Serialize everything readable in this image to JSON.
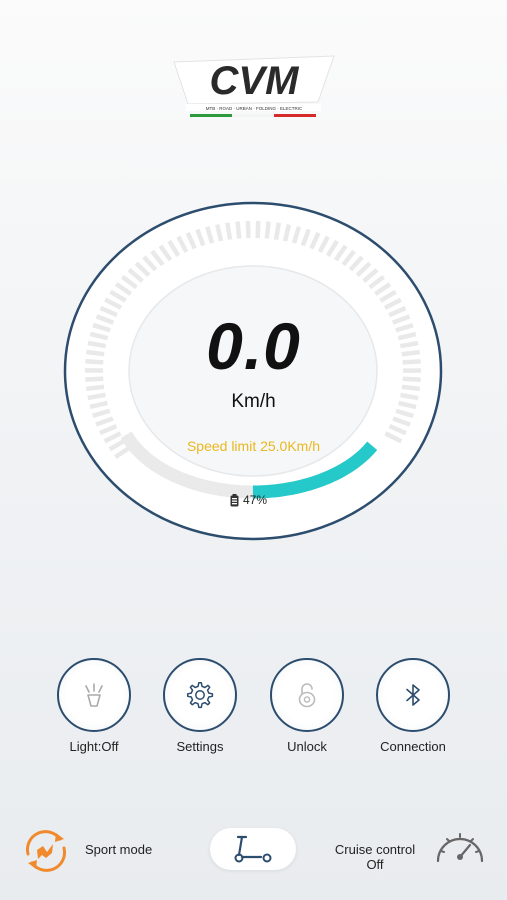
{
  "brand": {
    "logo_text": "CVM",
    "tagline": "MTB · ROAD · URBAN · FOLDING · ELECTRIC"
  },
  "dashboard": {
    "speed": "0.0",
    "unit": "Km/h",
    "speed_limit": "Speed limit  25.0Km/h",
    "battery_text": "47%",
    "battery_level": 0.47,
    "speed_level": 0.0
  },
  "controls": [
    {
      "label": "Light:Off",
      "icon": "headlight-icon"
    },
    {
      "label": "Settings",
      "icon": "gear-icon"
    },
    {
      "label": "Unlock",
      "icon": "unlock-icon"
    },
    {
      "label": "Connection",
      "icon": "bluetooth-icon"
    }
  ],
  "bottom_bar": {
    "sport_mode_label": "Sport mode",
    "cruise_label": "Cruise control",
    "cruise_state": "Off",
    "scooter_icon": "scooter-icon",
    "speedometer_icon": "speedometer-icon"
  },
  "colors": {
    "accent_teal": "#25c9c9",
    "limit_yellow": "#e9b820",
    "ring_navy": "#2d4d6e",
    "sport_orange": "#f08a2c"
  }
}
